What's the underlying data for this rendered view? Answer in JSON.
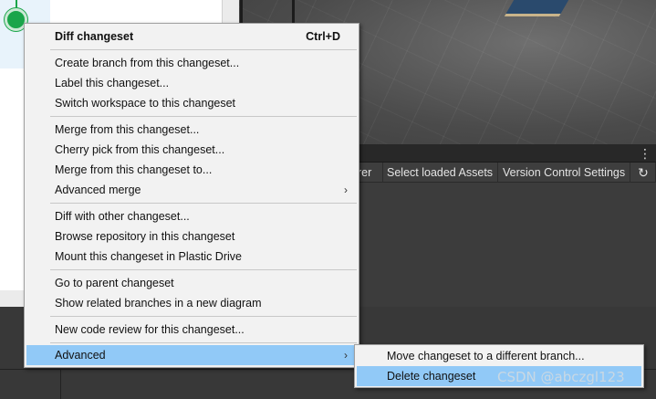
{
  "context_menu": {
    "header": {
      "label": "Diff changeset",
      "shortcut": "Ctrl+D"
    },
    "items": [
      {
        "label": "Create branch from this changeset..."
      },
      {
        "label": "Label this changeset..."
      },
      {
        "label": "Switch workspace to this changeset"
      },
      {
        "label": "Merge from this changeset..."
      },
      {
        "label": "Cherry pick from this changeset..."
      },
      {
        "label": "Merge from this changeset to..."
      },
      {
        "label": "Advanced merge",
        "submenu": true
      },
      {
        "label": "Diff with other changeset..."
      },
      {
        "label": "Browse repository in this changeset"
      },
      {
        "label": "Mount this changeset in Plastic Drive"
      },
      {
        "label": "Go to parent changeset"
      },
      {
        "label": "Show related branches in a new diagram"
      },
      {
        "label": "New code review for this changeset..."
      },
      {
        "label": "Advanced",
        "submenu": true,
        "highlighted": true
      }
    ],
    "submenu_arrow": "›"
  },
  "advanced_submenu": {
    "items": [
      {
        "label": "Move changeset to a different branch..."
      },
      {
        "label": "Delete changeset",
        "highlighted": true
      }
    ]
  },
  "editor_tabs": {
    "explorer_partial": "orer",
    "select_loaded_assets": "Select loaded Assets",
    "version_control_settings": "Version Control Settings",
    "refresh_icon": "↻",
    "more_icon": "⋮"
  },
  "watermark": "CSDN @abczgl123",
  "colors": {
    "menu_bg": "#f2f2f2",
    "highlight": "#91c9f7",
    "node_green": "#1aa54a",
    "editor_dark": "#3c3c3c"
  }
}
